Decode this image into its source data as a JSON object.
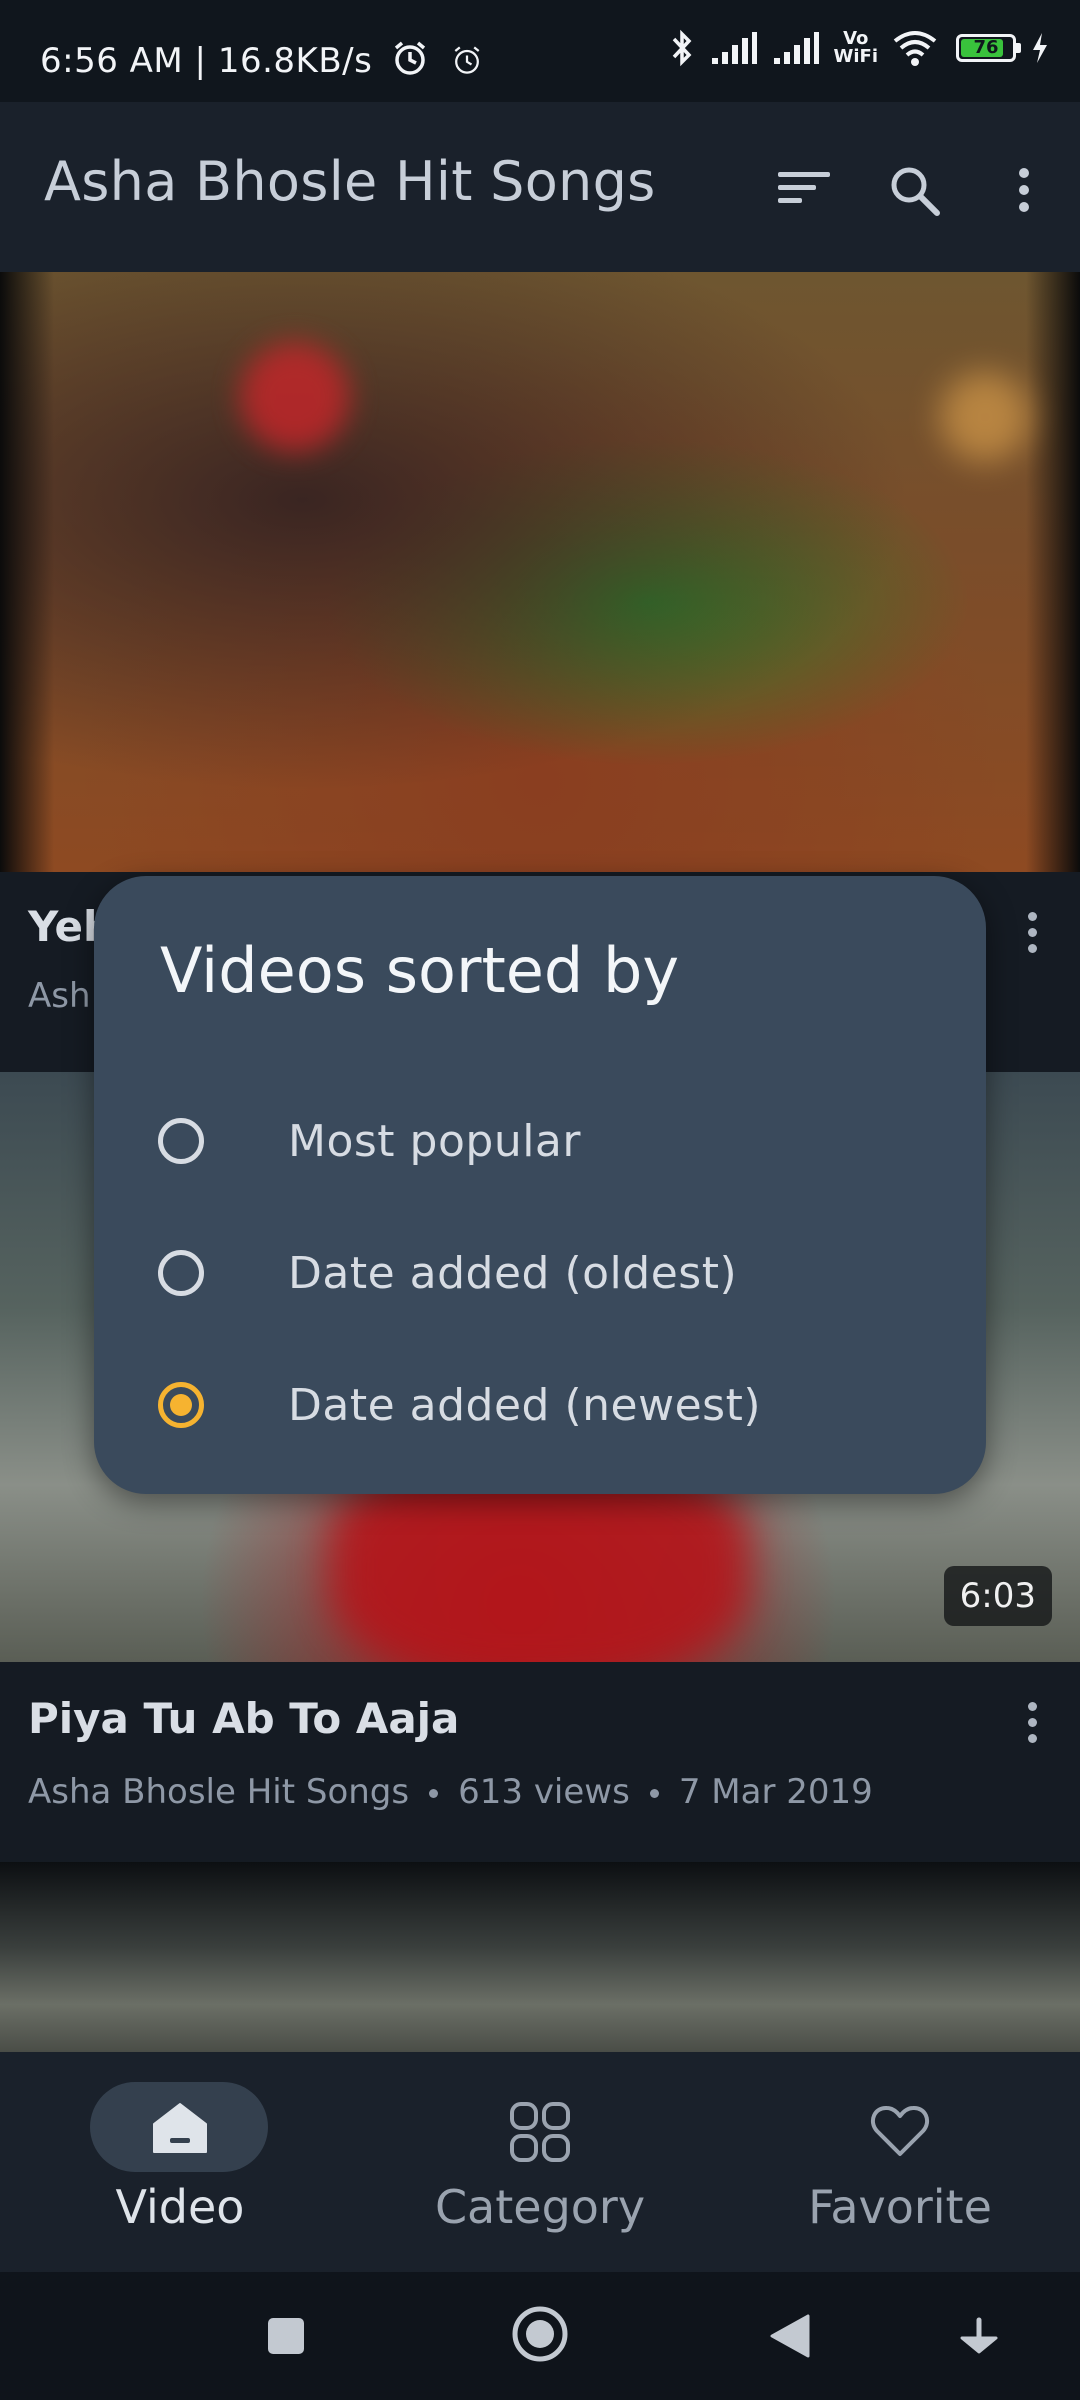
{
  "status_bar": {
    "time_speed": "6:56 AM | 16.8KB/s",
    "battery": "76",
    "wifi_calling_top": "Vo",
    "wifi_calling_bottom": "WiFi"
  },
  "app_bar": {
    "title": "Asha Bhosle Hit Songs",
    "icons": [
      "sort-icon",
      "search-icon",
      "more-vert-icon"
    ]
  },
  "videos": [
    {
      "title_partial": "Yeh",
      "subtitle_partial": "Ash"
    },
    {
      "title": "Piya Tu Ab To Aaja",
      "channel": "Asha Bhosle Hit Songs",
      "views": "613 views",
      "date": "7 Mar 2019",
      "duration": "6:03"
    }
  ],
  "dialog": {
    "title": "Videos sorted by",
    "options": [
      {
        "label": "Most popular",
        "selected": false
      },
      {
        "label": "Date added (oldest)",
        "selected": false
      },
      {
        "label": "Date added (newest)",
        "selected": true
      }
    ],
    "accent": "#f6b330"
  },
  "bottom_nav": {
    "items": [
      {
        "label": "Video",
        "icon": "home-icon",
        "active": true
      },
      {
        "label": "Category",
        "icon": "grid-icon",
        "active": false
      },
      {
        "label": "Favorite",
        "icon": "heart-icon",
        "active": false
      }
    ]
  },
  "system_nav": [
    "recents-square-icon",
    "home-circle-icon",
    "back-triangle-icon",
    "notification-pull-icon"
  ]
}
